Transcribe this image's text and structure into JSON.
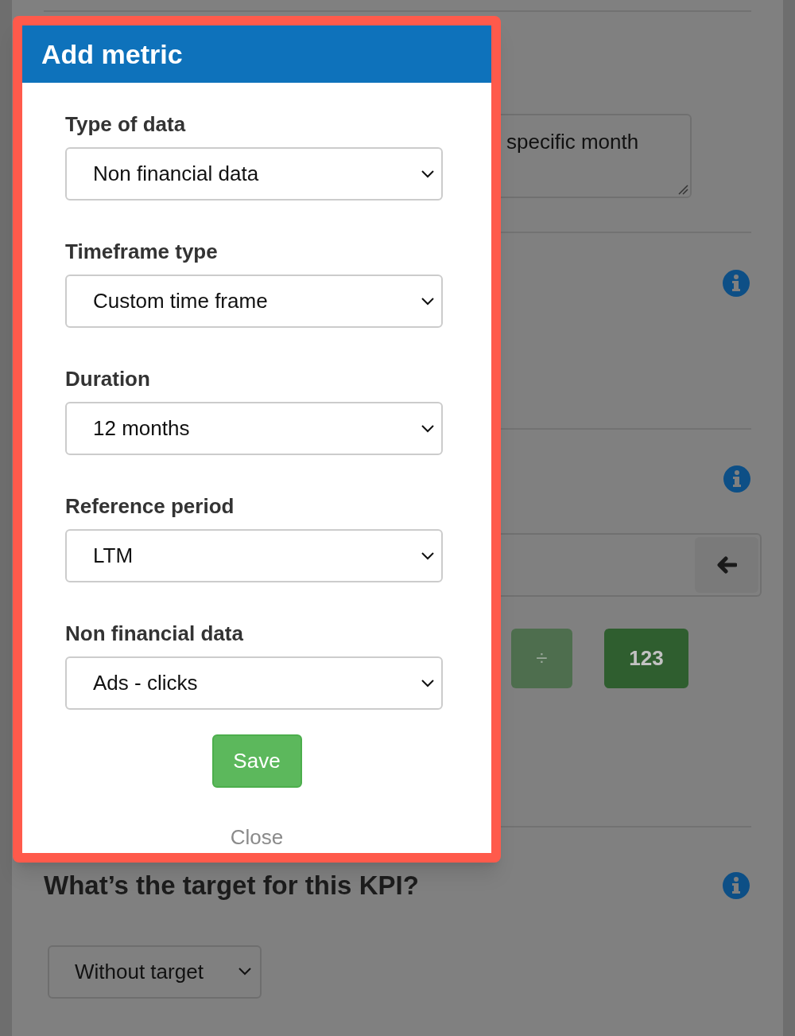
{
  "background": {
    "note_field": {
      "value": "specific month"
    },
    "formula": {
      "keys": [
        {
          "label": "÷",
          "kind": "operator"
        },
        {
          "label": "123",
          "kind": "number"
        }
      ]
    },
    "target": {
      "heading": "What’s the target for this KPI?",
      "select": "Without target"
    }
  },
  "modal": {
    "title": "Add metric",
    "fields": [
      {
        "label": "Type of data",
        "value": "Non financial data"
      },
      {
        "label": "Timeframe type",
        "value": "Custom time frame"
      },
      {
        "label": "Duration",
        "value": "12 months"
      },
      {
        "label": "Reference period",
        "value": "LTM"
      },
      {
        "label": "Non financial data",
        "value": "Ads - clicks"
      }
    ],
    "save": "Save",
    "close": "Close"
  }
}
